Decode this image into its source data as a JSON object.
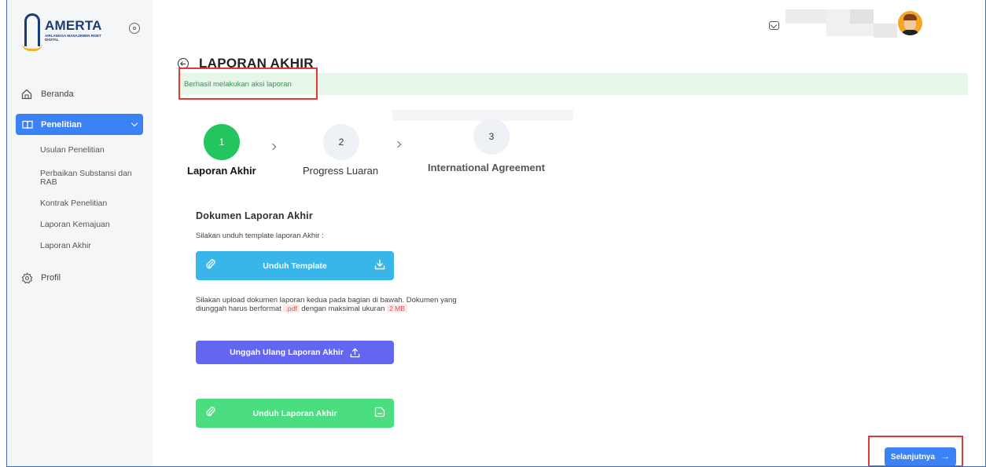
{
  "brand": {
    "name": "AMERTA",
    "subtitle": "AIRLANGGA MANAJEMEN RISET DIGITAL"
  },
  "sidebar": {
    "items": [
      {
        "label": "Beranda",
        "icon": "home-icon"
      },
      {
        "label": "Penelitian",
        "icon": "book-icon",
        "active": true
      },
      {
        "label": "Profil",
        "icon": "settings-icon"
      }
    ],
    "subitems": [
      {
        "label": "Usulan Penelitian"
      },
      {
        "label": "Perbaikan Substansi dan RAB"
      },
      {
        "label": "Kontrak Penelitian"
      },
      {
        "label": "Laporan Kemajuan"
      },
      {
        "label": "Laporan Akhir"
      }
    ]
  },
  "header": {
    "icons": [
      "mail-icon",
      "avatar"
    ]
  },
  "page": {
    "title": "LAPORAN AKHIR",
    "alert": "Berhasil melakukan aksi laporan"
  },
  "stepper": {
    "steps": [
      {
        "number": "1",
        "label": "Laporan Akhir",
        "state": "active"
      },
      {
        "number": "2",
        "label": "Progress Luaran",
        "state": "idle"
      },
      {
        "number": "3",
        "label": "International Agreement",
        "state": "idle"
      }
    ]
  },
  "document": {
    "title": "Dokumen Laporan Akhir",
    "template_hint": "Silakan unduh template laporan Akhir :",
    "download_template_label": "Unduh Template",
    "upload_hint_line1": "Silakan upload dokumen laporan kedua pada bagian di bawah. Dokumen yang",
    "upload_hint_line2_a": "diunggah harus berformat",
    "format_tag": ".pdf",
    "upload_hint_line2_b": "dengan maksimal ukuran",
    "size_tag": "2 MB",
    "reupload_label": "Unggah Ulang Laporan Akhir",
    "download_report_label": "Unduh Laporan Akhir"
  },
  "footer": {
    "next_label": "Selanjutnya",
    "next_arrow": "→"
  },
  "colors": {
    "primary": "#3b82f6",
    "success": "#22c55e",
    "alert_bg": "#e6f7ea",
    "highlight": "#e53935",
    "download_btn": "#38b6ea",
    "upload_btn": "#6366f1",
    "report_btn": "#4ade80"
  }
}
